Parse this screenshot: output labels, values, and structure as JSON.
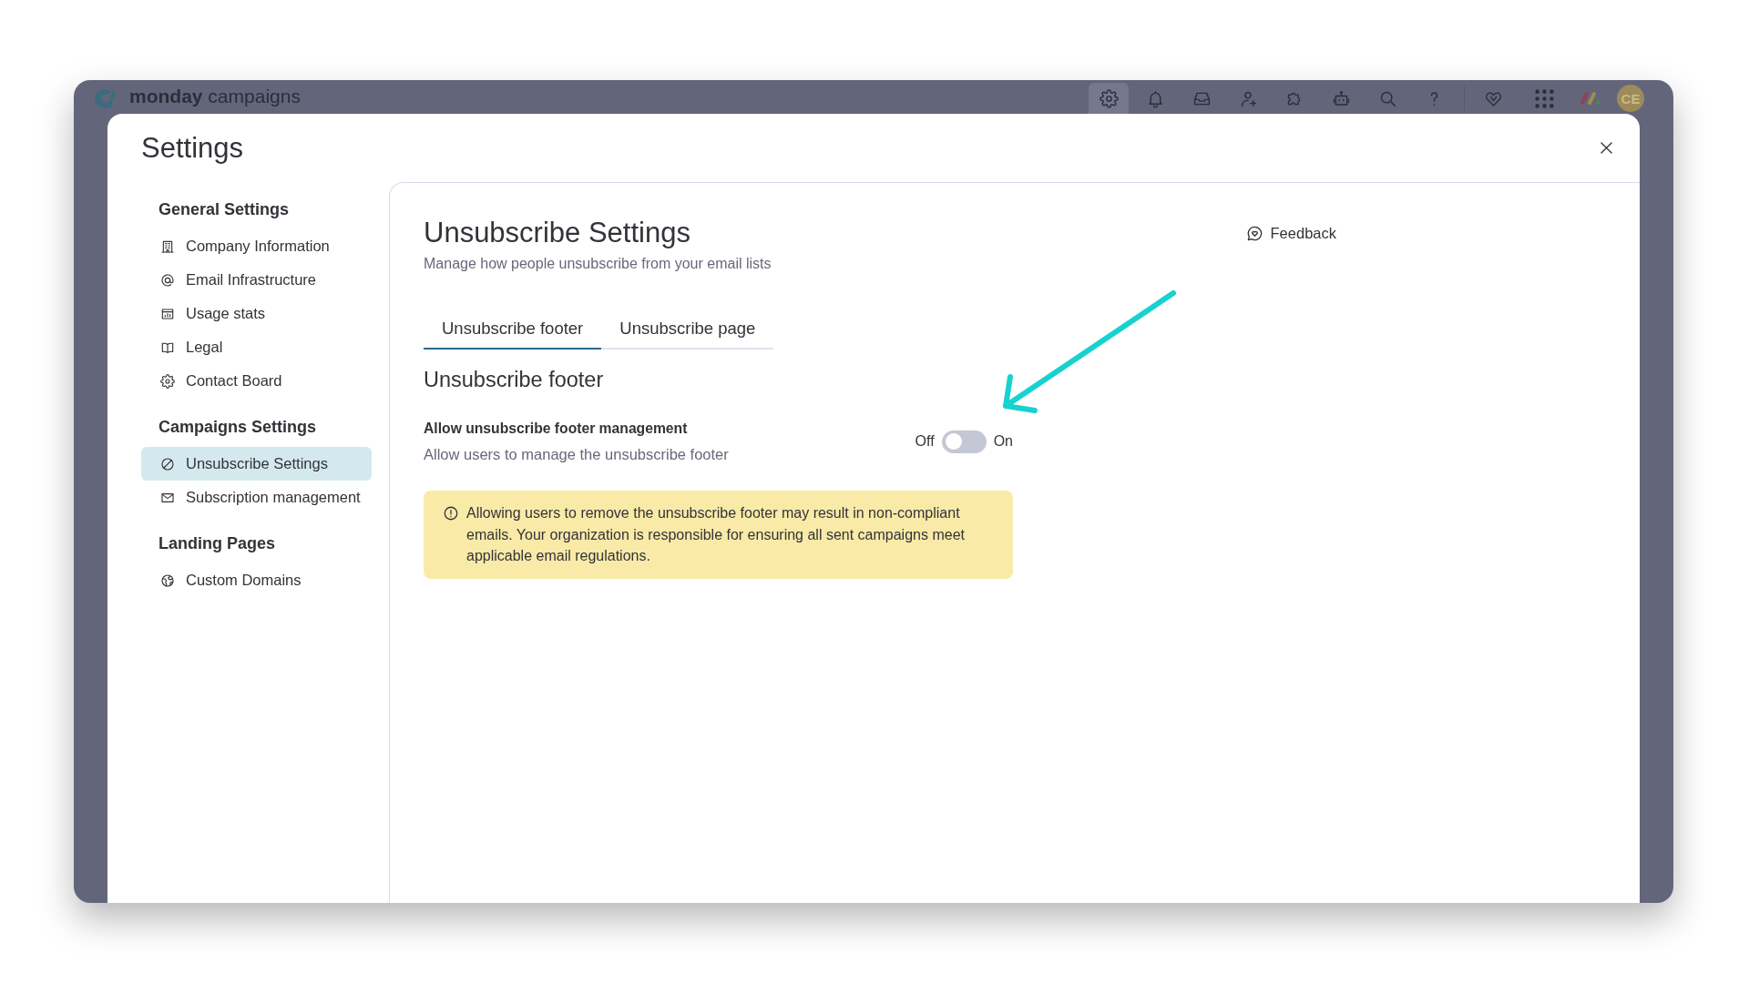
{
  "top_bar": {
    "logo": "**monday** campaigns",
    "settings_button": {
      "selected": true
    },
    "avatar": "CE"
  },
  "modal": {
    "title": "Settings"
  },
  "sidebar": {
    "sections": [
      {
        "heading": "General Settings",
        "items": [
          {
            "label": "Company Information",
            "selected": false
          },
          {
            "label": "Email Infrastructure",
            "selected": false
          },
          {
            "label": "Usage stats",
            "selected": false
          },
          {
            "label": "Legal",
            "selected": false
          },
          {
            "label": "Contact Board",
            "selected": false
          }
        ]
      },
      {
        "heading": "Campaigns Settings",
        "items": [
          {
            "label": "Unsubscribe Settings",
            "selected": true
          },
          {
            "label": "Subscription management",
            "selected": false
          }
        ]
      },
      {
        "heading": "Landing Pages",
        "items": [
          {
            "label": "Custom Domains",
            "selected": false
          }
        ]
      }
    ]
  },
  "page": {
    "title": "Unsubscribe Settings",
    "subtitle": "Manage how people unsubscribe from your email lists",
    "feedback_button": "Feedback",
    "tabs": [
      {
        "label": "Unsubscribe footer",
        "selected": true
      },
      {
        "label": "Unsubscribe page",
        "selected": false
      }
    ],
    "section_title": "Unsubscribe footer",
    "setting": {
      "label": "Allow unsubscribe footer management",
      "description": "Allow users to manage the unsubscribe footer",
      "off_label": "Off",
      "on_label": "On",
      "on": false
    },
    "warning": "Allowing users to remove the unsubscribe footer may result in non-compliant emails. Your organization is responsible for ensuring all sent campaigns meet applicable email regulations."
  }
}
